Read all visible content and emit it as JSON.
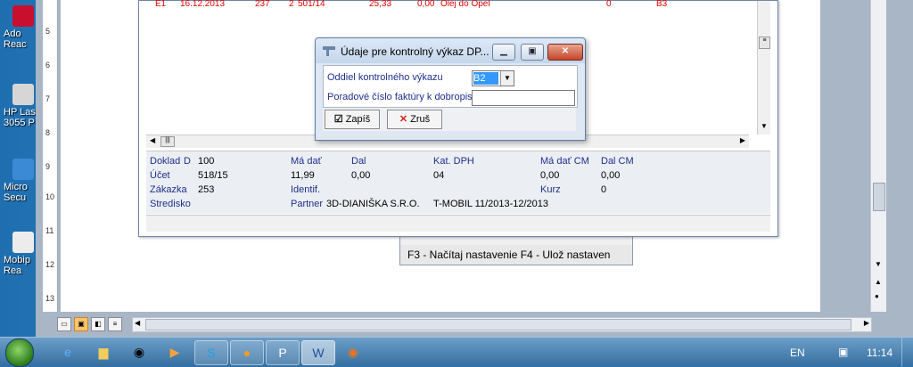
{
  "desktop_icons": [
    {
      "name": "adobe-reader",
      "label": "Ado\nReac"
    },
    {
      "name": "hp-laserjet",
      "label": "HP Las\n3055 P"
    },
    {
      "name": "microsoft-security",
      "label": "Micro\nSecu"
    },
    {
      "name": "mobipocket-reader",
      "label": "Mobip\nRea"
    }
  ],
  "ruler_marks": [
    "5",
    "6",
    "7",
    "8",
    "9",
    "10",
    "11",
    "12",
    "13"
  ],
  "grid_row": {
    "c1": "E1",
    "c2": "16.12.2013",
    "c3": "237",
    "c4": "2",
    "c5": "501/14",
    "c6": "25,33",
    "c7": "0,00",
    "c8": "Olej do Opel",
    "c9": "0",
    "c10": "B3"
  },
  "details": {
    "doklad_label": "Doklad",
    "doklad_type": "D",
    "doklad_value": "100",
    "ucet_label": "Účet",
    "ucet_value": "518/15",
    "zakazka_label": "Zákazka",
    "zakazka_value": "253",
    "stredisko_label": "Stredisko",
    "ma_dat_label": "Má dať",
    "ma_dat_value": "11,99",
    "identif_label": "Identif.",
    "partner_label": "Partner",
    "partner_value": "3D-DIANIŠKA S.R.O.",
    "dal_label": "Dal",
    "dal_value": "0,00",
    "kat_dph_label": "Kat. DPH",
    "kat_dph_value": "04",
    "note_value": "T-MOBIL 11/2013-12/2013",
    "ma_dat_cm_label": "Má dať CM",
    "ma_dat_cm_value": "0,00",
    "kurz_label": "Kurz",
    "dal_cm_label": "Dal CM",
    "dal_cm_value": "0,00",
    "kurz_value": "0"
  },
  "behind_window": {
    "keys": "F3 - Načítaj nastavenie    F4 - Ulož nastaven"
  },
  "dialog": {
    "title": "Údaje pre kontrolný výkaz DP...",
    "field1_label": "Oddiel kontrolného výkazu",
    "field1_value": "B2",
    "field2_label": "Poradové číslo faktúry k dobropisu",
    "field2_value": "",
    "save_label": "Zapíš",
    "cancel_label": "Zruš"
  },
  "taskbar": {
    "language": "EN",
    "time": "11:14"
  }
}
